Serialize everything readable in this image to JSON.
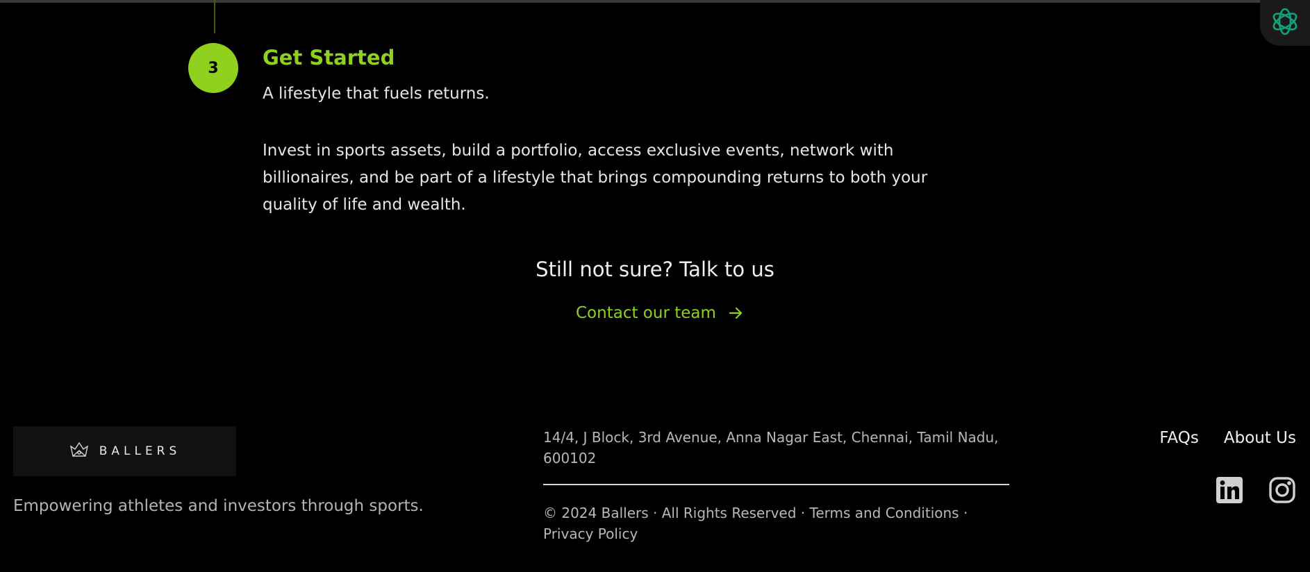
{
  "step": {
    "number": "3",
    "title": "Get Started",
    "subtitle": "A lifestyle that fuels returns.",
    "body": "Invest in sports assets, build a portfolio, access exclusive events, network with billionaires, and be part of a lifestyle that brings compounding returns to both your quality of life and wealth."
  },
  "cta": {
    "heading": "Still not sure? Talk to us",
    "link_label": "Contact our team",
    "link_icon": "arrow-right-icon"
  },
  "footer": {
    "brand": "BALLERS",
    "tagline": "Empowering athletes and investors through sports.",
    "address": "14/4, J Block, 3rd Avenue, Anna Nagar East, Chennai, Tamil Nadu, 600102",
    "legal": {
      "copyright": "© 2024 Ballers",
      "separator": " · ",
      "rights": "All Rights Reserved",
      "terms": "Terms and Conditions",
      "privacy": "Privacy Policy"
    },
    "nav": {
      "faqs": "FAQs",
      "about": "About Us"
    },
    "social": [
      "linkedin-icon",
      "instagram-icon"
    ]
  },
  "colors": {
    "accent": "#8fd11c",
    "background": "#000000",
    "assistant": "#10a37f"
  }
}
